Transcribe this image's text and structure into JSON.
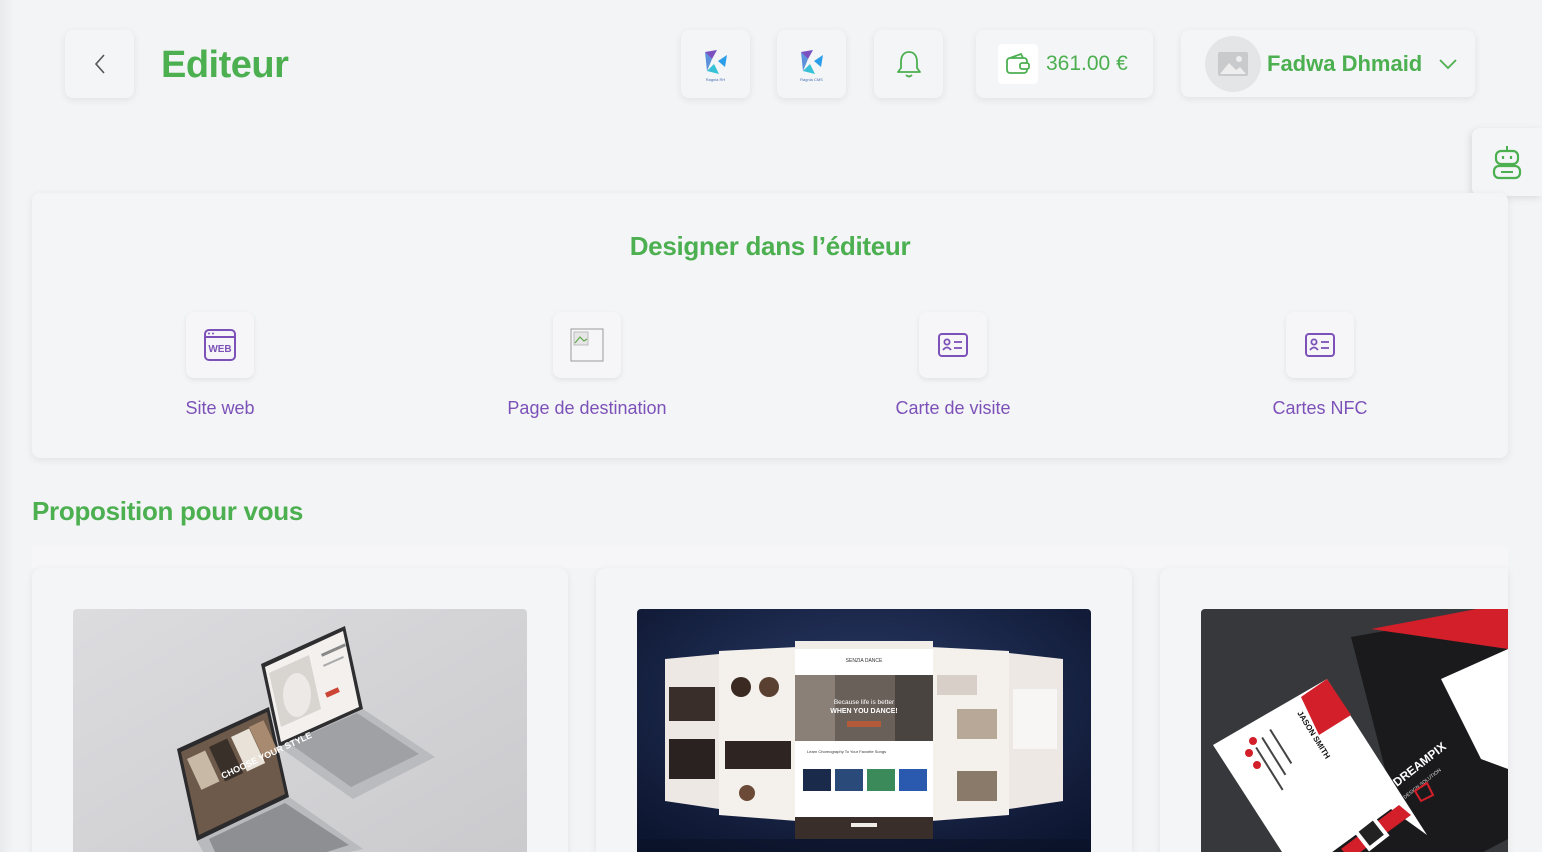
{
  "header": {
    "title": "Editeur",
    "logo1_caption": "Ragnia RH",
    "logo2_caption": "Ragnia CMS",
    "wallet_amount": "361.00 €",
    "user_name": "Fadwa Dhmaid"
  },
  "design": {
    "title": "Designer dans l’éditeur",
    "options": [
      {
        "label": "Site web",
        "icon": "web-icon"
      },
      {
        "label": "Page de destination",
        "icon": "broken-image-icon"
      },
      {
        "label": "Carte de visite",
        "icon": "id-card-icon"
      },
      {
        "label": "Cartes NFC",
        "icon": "id-card-icon"
      }
    ]
  },
  "proposals": {
    "title": "Proposition pour vous",
    "web_mockup": {
      "banner": "CHOOSE YOUR STYLE"
    },
    "dance_mockup": {
      "headline": "Because life is better",
      "headline2": "WHEN YOU DANCE!",
      "section": "Learn Choreography To Your Favorite Songs",
      "brand": "SENZIA DANCE"
    },
    "business_card": {
      "name": "JASON SMITH",
      "brand": "DREAMPIX",
      "tagline": "DESIGN SOLUTION"
    }
  },
  "colors": {
    "accent": "#4caf50",
    "purple": "#7c52b8",
    "background": "#f3f4f6"
  }
}
